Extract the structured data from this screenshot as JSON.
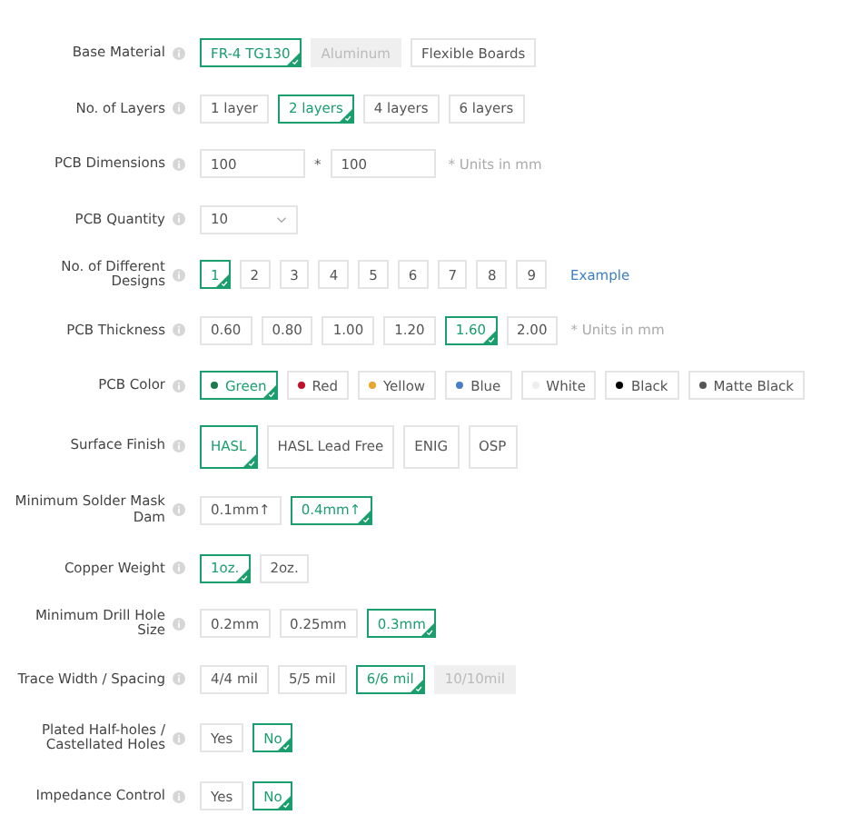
{
  "rows": [
    {
      "label": "Base Material",
      "kind": "options",
      "options": [
        {
          "text": "FR-4 TG130",
          "selected": true,
          "disabled": false
        },
        {
          "text": "Aluminum",
          "selected": false,
          "disabled": true
        },
        {
          "text": "Flexible Boards",
          "selected": false,
          "disabled": false
        }
      ]
    },
    {
      "label": "No. of Layers",
      "kind": "options",
      "options": [
        {
          "text": "1 layer",
          "selected": false,
          "disabled": false
        },
        {
          "text": "2 layers",
          "selected": true,
          "disabled": false
        },
        {
          "text": "4 layers",
          "selected": false,
          "disabled": false
        },
        {
          "text": "6 layers",
          "selected": false,
          "disabled": false
        }
      ]
    },
    {
      "label": "PCB Dimensions",
      "kind": "dimensions",
      "fields": [
        {
          "value": "100"
        },
        {
          "value": "100"
        }
      ],
      "separator": "*",
      "note": "* Units in mm"
    },
    {
      "label": "PCB Quantity",
      "kind": "select",
      "value": "10"
    },
    {
      "label": "No. of Different Designs",
      "kind": "options",
      "link": "Example",
      "options": [
        {
          "text": "1",
          "selected": true,
          "disabled": false
        },
        {
          "text": "2",
          "selected": false,
          "disabled": false
        },
        {
          "text": "3",
          "selected": false,
          "disabled": false
        },
        {
          "text": "4",
          "selected": false,
          "disabled": false
        },
        {
          "text": "5",
          "selected": false,
          "disabled": false
        },
        {
          "text": "6",
          "selected": false,
          "disabled": false
        },
        {
          "text": "7",
          "selected": false,
          "disabled": false
        },
        {
          "text": "8",
          "selected": false,
          "disabled": false
        },
        {
          "text": "9",
          "selected": false,
          "disabled": false
        }
      ]
    },
    {
      "label": "PCB Thickness",
      "kind": "options",
      "note": "* Units in mm",
      "options": [
        {
          "text": "0.60",
          "selected": false,
          "disabled": false
        },
        {
          "text": "0.80",
          "selected": false,
          "disabled": false
        },
        {
          "text": "1.00",
          "selected": false,
          "disabled": false
        },
        {
          "text": "1.20",
          "selected": false,
          "disabled": false
        },
        {
          "text": "1.60",
          "selected": true,
          "disabled": false
        },
        {
          "text": "2.00",
          "selected": false,
          "disabled": false
        }
      ]
    },
    {
      "label": "PCB Color",
      "kind": "options",
      "options": [
        {
          "text": "Green",
          "selected": true,
          "disabled": false,
          "color": "#1a7a4c"
        },
        {
          "text": "Red",
          "selected": false,
          "disabled": false,
          "color": "#c0102a"
        },
        {
          "text": "Yellow",
          "selected": false,
          "disabled": false,
          "color": "#e8a62a"
        },
        {
          "text": "Blue",
          "selected": false,
          "disabled": false,
          "color": "#4a7fc8"
        },
        {
          "text": "White",
          "selected": false,
          "disabled": false,
          "color": "#eeeeee"
        },
        {
          "text": "Black",
          "selected": false,
          "disabled": false,
          "color": "#000000"
        },
        {
          "text": "Matte Black",
          "selected": false,
          "disabled": false,
          "color": "#555555"
        }
      ]
    },
    {
      "label": "Surface Finish",
      "kind": "tall_options",
      "options": [
        {
          "text": "HASL",
          "selected": true,
          "disabled": false
        },
        {
          "text": "HASL Lead Free",
          "selected": false,
          "disabled": false
        },
        {
          "text": "ENIG",
          "selected": false,
          "disabled": false
        },
        {
          "text": "OSP",
          "selected": false,
          "disabled": false
        }
      ]
    },
    {
      "label": "Minimum Solder Mask Dam",
      "kind": "options",
      "options": [
        {
          "text": "0.1mm↑",
          "selected": false,
          "disabled": false
        },
        {
          "text": "0.4mm↑",
          "selected": true,
          "disabled": false
        }
      ]
    },
    {
      "label": "Copper Weight",
      "kind": "options",
      "options": [
        {
          "text": "1oz.",
          "selected": true,
          "disabled": false
        },
        {
          "text": "2oz.",
          "selected": false,
          "disabled": false
        }
      ]
    },
    {
      "label": "Minimum Drill Hole Size",
      "kind": "options",
      "options": [
        {
          "text": "0.2mm",
          "selected": false,
          "disabled": false
        },
        {
          "text": "0.25mm",
          "selected": false,
          "disabled": false
        },
        {
          "text": "0.3mm",
          "selected": true,
          "disabled": false
        }
      ]
    },
    {
      "label": "Trace Width / Spacing",
      "kind": "options",
      "options": [
        {
          "text": "4/4 mil",
          "selected": false,
          "disabled": false
        },
        {
          "text": "5/5 mil",
          "selected": false,
          "disabled": false
        },
        {
          "text": "6/6 mil",
          "selected": true,
          "disabled": false
        },
        {
          "text": "10/10mil",
          "selected": false,
          "disabled": true
        }
      ]
    },
    {
      "label": "Plated Half-holes / Castellated Holes",
      "kind": "options",
      "options": [
        {
          "text": "Yes",
          "selected": false,
          "disabled": false
        },
        {
          "text": "No",
          "selected": true,
          "disabled": false
        }
      ]
    },
    {
      "label": "Impedance Control",
      "kind": "options",
      "options": [
        {
          "text": "Yes",
          "selected": false,
          "disabled": false
        },
        {
          "text": "No",
          "selected": true,
          "disabled": false
        }
      ]
    }
  ]
}
